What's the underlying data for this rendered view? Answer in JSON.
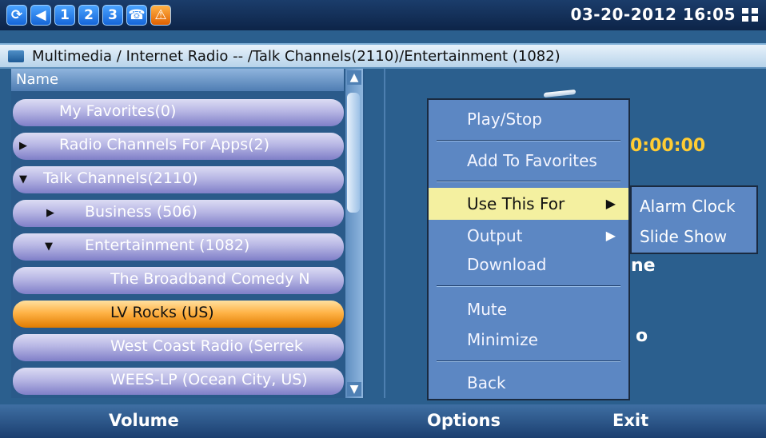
{
  "status": {
    "icons": [
      {
        "name": "system-icon",
        "label": "⟳"
      },
      {
        "name": "volume-icon",
        "label": "◀"
      },
      {
        "name": "line1-icon",
        "label": "1"
      },
      {
        "name": "line2-icon",
        "label": "2"
      },
      {
        "name": "line3-icon",
        "label": "3"
      },
      {
        "name": "headset-icon",
        "label": "☎"
      },
      {
        "name": "alert-icon",
        "label": "⚠"
      }
    ],
    "datetime": "03-20-2012 16:05"
  },
  "breadcrumb": {
    "path": "Multimedia / Internet Radio  --  /Talk Channels(2110)/Entertainment (1082)"
  },
  "list": {
    "header": "Name",
    "items": [
      {
        "label": "My Favorites(0)",
        "expander": ""
      },
      {
        "label": "Radio Channels For Apps(2)",
        "expander": "▶"
      },
      {
        "label": "Talk Channels(2110)",
        "expander": "▼"
      },
      {
        "label": "Business (506)",
        "expander": "▶"
      },
      {
        "label": "Entertainment (1082)",
        "expander": "▼"
      },
      {
        "label": "The Broadband Comedy N",
        "expander": ""
      },
      {
        "label": "LV Rocks (US)",
        "expander": "",
        "selected": true
      },
      {
        "label": "West Coast Radio (Serrek",
        "expander": ""
      },
      {
        "label": "WEES-LP (Ocean City, US)",
        "expander": ""
      }
    ]
  },
  "player": {
    "time": "0:00:00",
    "fragment_1": "ne",
    "fragment_2": "o"
  },
  "menu": {
    "items": [
      {
        "label": "Play/Stop"
      },
      {
        "label": "Add To Favorites"
      },
      {
        "label": "Use This For",
        "highlighted": true,
        "has_submenu": true
      },
      {
        "label": "Output",
        "has_submenu": true
      },
      {
        "label": "Download"
      },
      {
        "label": "Mute"
      },
      {
        "label": "Minimize"
      },
      {
        "label": "Back"
      }
    ],
    "submenu": [
      "Alarm Clock",
      "Slide Show"
    ]
  },
  "softkeys": {
    "left": "Volume",
    "center": "Options",
    "right": "Exit"
  },
  "colors": {
    "selected_row": "#ffb347",
    "menu_highlight": "#f4f0a0",
    "time_accent": "#ffcc33",
    "menu_bg": "#5c87c3"
  }
}
